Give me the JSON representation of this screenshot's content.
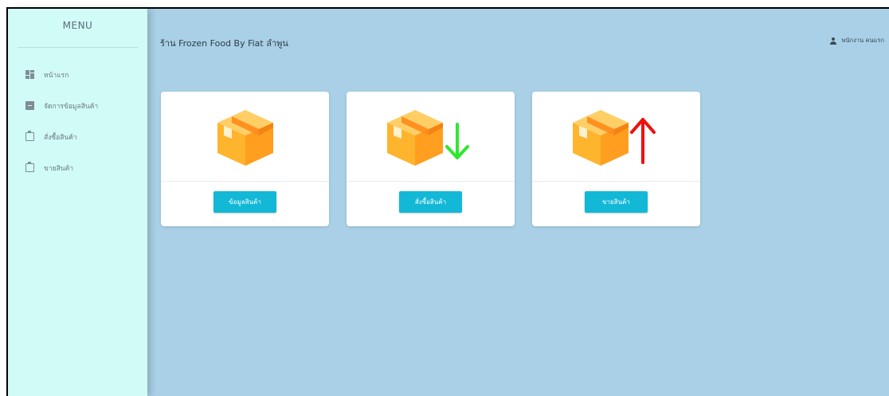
{
  "sidebar": {
    "title": "MENU",
    "items": [
      {
        "label": "หน้าแรก",
        "icon": "dashboard-icon"
      },
      {
        "label": "จัดการข้อมูลสินค้า",
        "icon": "archive-icon"
      },
      {
        "label": "สั่งซื้อสินค้า",
        "icon": "clipboard-icon"
      },
      {
        "label": "ขายสินค้า",
        "icon": "clipboard-icon"
      }
    ]
  },
  "header": {
    "shop_title": "ร้าน Frozen Food By Fiat ลำพูน",
    "user_label": "พนักงาน คนแรก",
    "user_icon": "user-icon"
  },
  "cards": [
    {
      "button_label": "ข้อมูลสินค้า",
      "image": "box-icon",
      "arrow": "none"
    },
    {
      "button_label": "สั่งซื้อสินค้า",
      "image": "box-icon",
      "arrow": "down"
    },
    {
      "button_label": "ขายสินค้า",
      "image": "box-icon",
      "arrow": "up"
    }
  ],
  "colors": {
    "sidebar_bg": "#d1fbf6",
    "content_bg": "#a9d0e6",
    "button": "#13b8d6",
    "arrow_down": "#2ee82e",
    "arrow_up": "#ee1111"
  }
}
